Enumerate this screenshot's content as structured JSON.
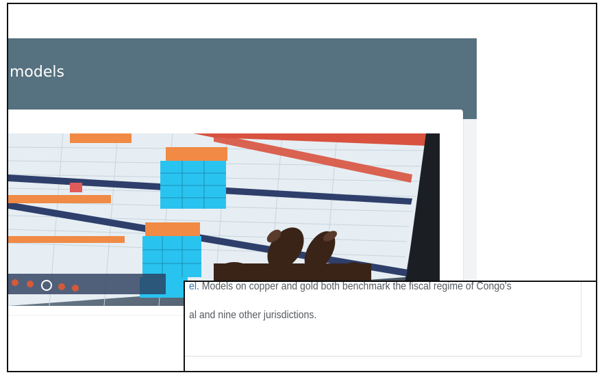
{
  "header": {
    "title": "models"
  },
  "image": {
    "alt": "Tablet showing fiscal model spreadsheet",
    "icon": "spreadsheet-photo"
  },
  "caption": {
    "link_fragment": "el.",
    "line1_rest": " Models on copper and gold both benchmark the fiscal regime of Congo's",
    "line2": "al and nine other jurisdictions."
  },
  "colors": {
    "header_bg": "#56717f",
    "link": "#2d6fb7",
    "text": "#555a5e"
  }
}
